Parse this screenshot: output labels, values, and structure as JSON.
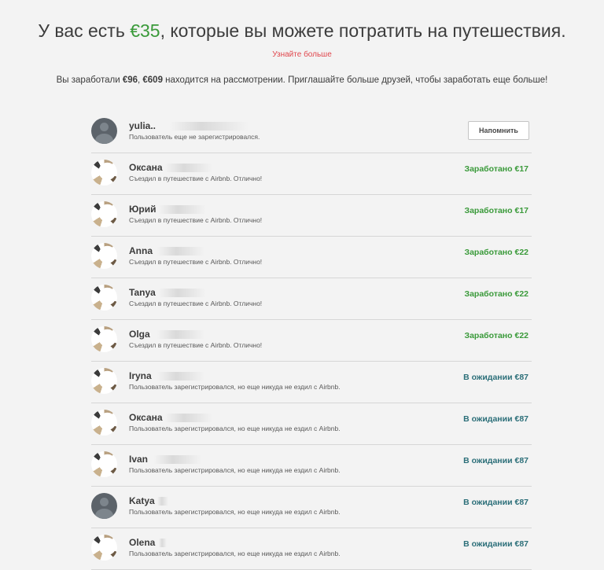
{
  "header": {
    "title_prefix": "У вас есть ",
    "title_amount": "€35",
    "title_suffix": ", которые вы можете потратить на путешествия.",
    "learn_more": "Узнайте больше"
  },
  "earnings": {
    "prefix": "Вы заработали ",
    "earned": "€96",
    "separator": ", ",
    "pending": "€609",
    "suffix": " находится на рассмотрении. Приглашайте больше друзей, чтобы заработать еще больше!"
  },
  "colors": {
    "success": "#3a9a3a",
    "pending": "#2c6f79",
    "accent_link": "#e0464c"
  },
  "referrals": [
    {
      "name": "yulia..",
      "status": "Пользователь еще не зарегистрировался.",
      "action_label": "Напомнить",
      "avatar": "default-user-icon"
    },
    {
      "name": "Оксана",
      "status": "Съездил в путешествие с Airbnb. Отлично!",
      "value": "Заработано €17",
      "state": "success",
      "avatar": "photo"
    },
    {
      "name": "Юрий",
      "status": "Съездил в путешествие с Airbnb. Отлично!",
      "value": "Заработано €17",
      "state": "success",
      "avatar": "photo"
    },
    {
      "name": "Anna",
      "status": "Съездил в путешествие с Airbnb. Отлично!",
      "value": "Заработано €22",
      "state": "success",
      "avatar": "photo"
    },
    {
      "name": "Tanya",
      "status": "Съездил в путешествие с Airbnb. Отлично!",
      "value": "Заработано €22",
      "state": "success",
      "avatar": "photo"
    },
    {
      "name": "Olga",
      "status": "Съездил в путешествие с Airbnb. Отлично!",
      "value": "Заработано €22",
      "state": "success",
      "avatar": "photo"
    },
    {
      "name": "Iryna",
      "status": "Пользователь зарегистрировался, но еще никуда не ездил с Airbnb.",
      "value": "В ожидании €87",
      "state": "pending",
      "avatar": "photo"
    },
    {
      "name": "Оксана",
      "status": "Пользователь зарегистрировался, но еще никуда не ездил с Airbnb.",
      "value": "В ожидании €87",
      "state": "pending",
      "avatar": "photo"
    },
    {
      "name": "Ivan",
      "status": "Пользователь зарегистрировался, но еще никуда не ездил с Airbnb.",
      "value": "В ожидании €87",
      "state": "pending",
      "avatar": "photo"
    },
    {
      "name": "Katya",
      "status": "Пользователь зарегистрировался, но еще никуда не ездил с Airbnb.",
      "value": "В ожидании €87",
      "state": "pending",
      "avatar": "default-user-icon"
    },
    {
      "name": "Olena",
      "status": "Пользователь зарегистрировался, но еще никуда не ездил с Airbnb.",
      "value": "В ожидании €87",
      "state": "pending",
      "avatar": "photo"
    }
  ]
}
